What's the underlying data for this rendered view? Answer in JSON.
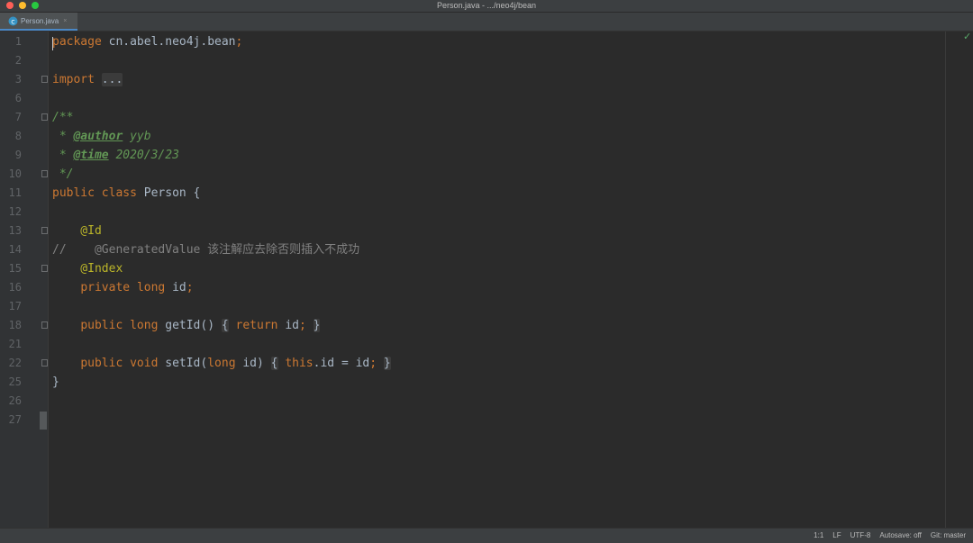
{
  "window": {
    "title": "Person.java - .../neo4j/bean",
    "lights": [
      "#fe5f57",
      "#febc2e",
      "#28c840"
    ]
  },
  "tab": {
    "label": "Person.java",
    "close": "×",
    "icon": "java-class-icon"
  },
  "editor": {
    "check": "✓",
    "code": {
      "l1_kw": "package",
      "l1_rest": " cn.abel.neo4j.bean",
      "semi": ";",
      "l3_kw": "import",
      "l3_fold": "...",
      "l7": "/**",
      "doc_star": " * ",
      "author_tag": "@author",
      "author_val": " yyb",
      "time_tag": "@time",
      "time_val": " 2020/3/23",
      "l10": " */",
      "public": "public",
      "class": "class",
      "cls": " Person {",
      "id_ann": "    @Id",
      "l14": "//    @GeneratedValue 该注解应去除否则插入不成功",
      "index_ann": "    @Index",
      "private": "private",
      "long": "long",
      "void": "void",
      "l16_rest": " id",
      "getid": " getId() ",
      "lbrace": "{",
      "rbrace": "}",
      "return": "return",
      "ret_rest": " id",
      "setid": " setId(",
      "param": " id) ",
      "this": "this",
      "assign": ".id = id",
      "close_brace": "}",
      "indent": "    ",
      "sp": " "
    },
    "line_numbers": [
      "1",
      "2",
      "3",
      "6",
      "7",
      "8",
      "9",
      "10",
      "11",
      "12",
      "13",
      "14",
      "15",
      "16",
      "17",
      "18",
      "21",
      "22",
      "25",
      "26",
      "27"
    ]
  },
  "status": {
    "position": "1:1",
    "line_sep": "LF",
    "encoding": "UTF-8",
    "autosave": "Autosave: off",
    "git": "Git: master"
  }
}
